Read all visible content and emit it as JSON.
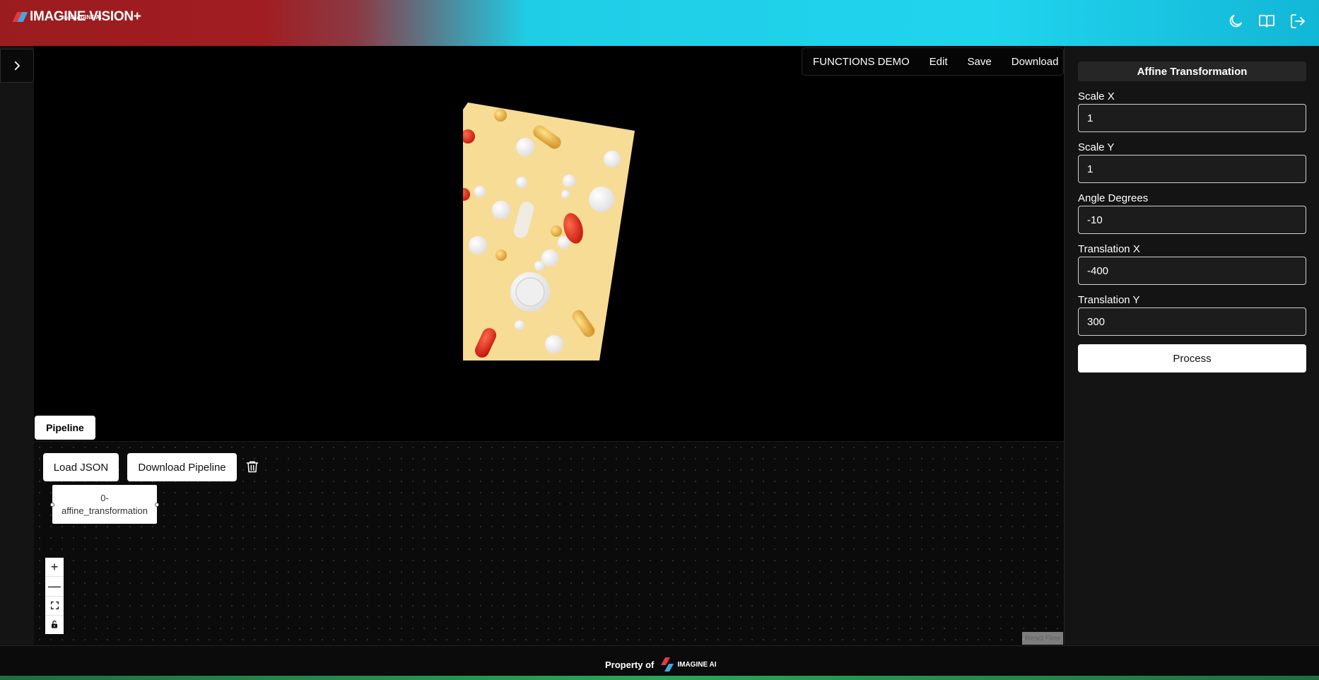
{
  "header": {
    "brand": "IMAGINE VISION+",
    "by": "by",
    "sub_brand": "IMAGINE AI",
    "icons": [
      "moon-icon",
      "book-icon",
      "logout-icon"
    ]
  },
  "top_menu": {
    "items": [
      "FUNCTIONS DEMO",
      "Edit",
      "Save",
      "Download"
    ]
  },
  "pipeline": {
    "tab_label": "Pipeline",
    "load_json": "Load JSON",
    "download_pipeline": "Download Pipeline",
    "node_line1": "0-",
    "node_line2": "affine_transformation",
    "attribution": "React Flow",
    "controls": [
      "+",
      "—",
      "⛶",
      "🔒"
    ]
  },
  "panel": {
    "title": "Affine Transformation",
    "fields": [
      {
        "label": "Scale X",
        "value": "1"
      },
      {
        "label": "Scale Y",
        "value": "1"
      },
      {
        "label": "Angle Degrees",
        "value": "-10"
      },
      {
        "label": "Translation X",
        "value": "-400"
      },
      {
        "label": "Translation Y",
        "value": "300"
      }
    ],
    "process": "Process"
  },
  "footer": {
    "property_of": "Property of",
    "brand": "IMAGINE AI"
  },
  "colors": {
    "accent_cyan": "#21d4ee",
    "brand_red": "#a11d22",
    "pill_background": "#f7dc96"
  }
}
